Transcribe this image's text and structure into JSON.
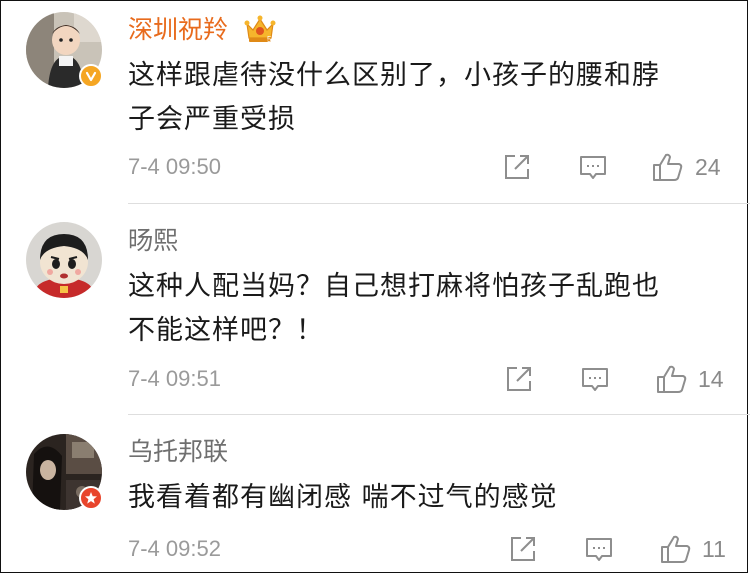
{
  "colors": {
    "vip_name": "#e86b1d",
    "normal_name": "#6f6f6f",
    "timestamp": "#9a9a9a",
    "icon": "#8e8e8e"
  },
  "comments": [
    {
      "username": "深圳祝羚",
      "vip": true,
      "lines": [
        "这样跟虐待没什么区别了，小孩子的腰和脖",
        "子会严重受损"
      ],
      "time": "7-4 09:50",
      "likes": "24"
    },
    {
      "username": "旸熙",
      "vip": false,
      "lines": [
        "这种人配当妈？自己想打麻将怕孩子乱跑也",
        "不能这样吧？！"
      ],
      "time": "7-4 09:51",
      "likes": "14"
    },
    {
      "username": "乌托邦联",
      "vip": false,
      "lines": [
        "我看着都有幽闭感  喘不过气的感觉"
      ],
      "time": "7-4 09:52",
      "likes": "11"
    }
  ],
  "icons": {
    "share": "share-icon",
    "comment": "comment-icon",
    "like": "thumbs-up-icon",
    "vip_crown": "crown-icon",
    "verified": "verified-badge-icon"
  }
}
